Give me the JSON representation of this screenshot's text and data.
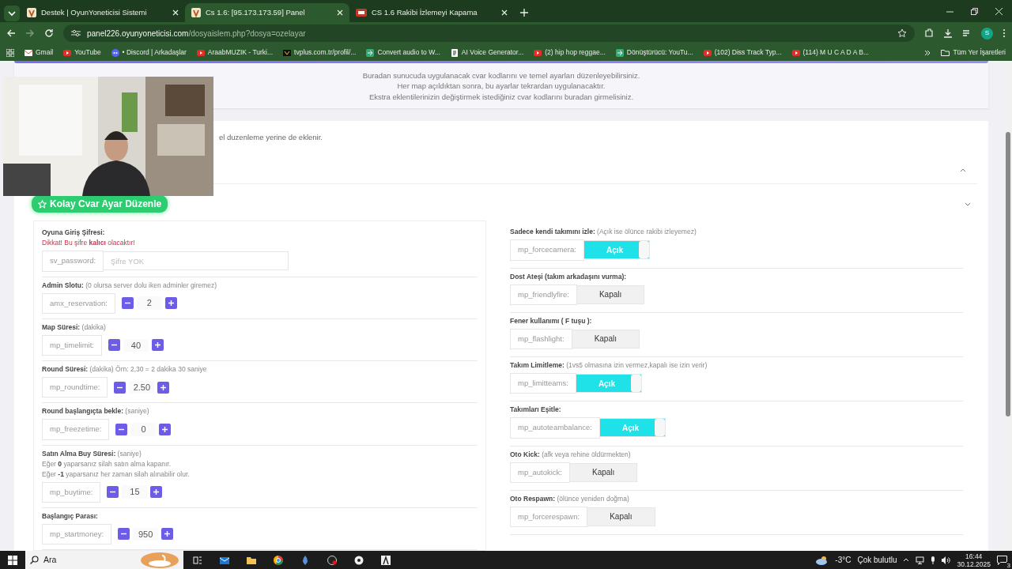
{
  "browser": {
    "tabs": [
      {
        "title": "Destek | OyunYoneticisi Sistemi",
        "kind": "shield",
        "selected": false
      },
      {
        "title": "Cs 1.6: [95.173.173.59] Panel",
        "kind": "shield",
        "selected": true
      },
      {
        "title": "CS 1.6 Rakibi İzlemeyi Kapama",
        "kind": "badge",
        "selected": false
      }
    ],
    "url": {
      "host": "panel226.oyunyoneticisi.com",
      "path": "/dosyaislem.php?dosya=ozelayar"
    },
    "profile": "S",
    "bookmarks": [
      {
        "label": "Gmail",
        "kind": "gmail"
      },
      {
        "label": "YouTube",
        "kind": "youtube"
      },
      {
        "label": "• Discord | Arkadaşlar",
        "kind": "discord"
      },
      {
        "label": "AraabMUZIK - Turki...",
        "kind": "youtube"
      },
      {
        "label": "tvplus.com.tr/profil/...",
        "kind": "tv"
      },
      {
        "label": "Convert audio to W...",
        "kind": "convert"
      },
      {
        "label": "AI Voice Generator...",
        "kind": "ai"
      },
      {
        "label": "(2) hip hop reggae...",
        "kind": "youtube"
      },
      {
        "label": "Dönüştürücü: YouTu...",
        "kind": "convert"
      },
      {
        "label": "(102) Diss Track Typ...",
        "kind": "youtube"
      },
      {
        "label": "(114) M U C A D A B...",
        "kind": "youtube"
      }
    ],
    "all_bookmarks": "Tüm Yer İşaretleri"
  },
  "page": {
    "info_lines": [
      "Buradan sunucuda uygulanacak cvar kodlarını ve temel ayarları düzenleyebilirsiniz.",
      "Her map açıldıktan sonra, bu ayarlar tekrardan uygulanacaktır.",
      "Ekstra eklentilerinizin değiştirmek istediğiniz cvar kodlarını buradan girmelisiniz."
    ],
    "note": "el duzenleme yerine de eklenir.",
    "section_title": "Kolay Cvar Ayar Düzenle",
    "left_settings": [
      {
        "label": "Oyuna Giriş Şifresi:",
        "warning": "Dikkat! Bu şifre **kalıcı** olacaktır!",
        "cvar": "sv_password:",
        "kind": "text",
        "placeholder": "Şifre YOK"
      },
      {
        "label": "Admin Slotu:",
        "hint": "(0 olursa server dolu iken adminler giremez)",
        "cvar": "amx_reservation:",
        "kind": "number",
        "value": "2"
      },
      {
        "label": "Map Süresi:",
        "hint": "(dakika)",
        "cvar": "mp_timelimit:",
        "kind": "number",
        "value": "40"
      },
      {
        "label": "Round Süresi:",
        "hint": "(dakika) Örn: 2,30 = 2 dakika 30 saniye",
        "cvar": "mp_roundtime:",
        "kind": "number",
        "value": "2.50"
      },
      {
        "label": "Round başlangıçta bekle:",
        "hint": "(saniye)",
        "cvar": "mp_freezetime:",
        "kind": "number",
        "value": "0"
      },
      {
        "label": "Satın Alma Buy Süresi:",
        "hint": "(saniye)",
        "notes": [
          "Eğer **0** yaparsanız silah satın alma kapanır.",
          "Eğer **-1** yaparsanız her zaman silah alınabilir olur."
        ],
        "cvar": "mp_buytime:",
        "kind": "number",
        "value": "15"
      },
      {
        "label": "Başlangıç Parası:",
        "cvar": "mp_startmoney:",
        "kind": "number",
        "value": "950"
      }
    ],
    "right_settings": [
      {
        "label": "Sadece kendi takımını izle:",
        "hint": "(Açık ise ölünce rakibi izleyemez)",
        "cvar": "mp_forcecamera:",
        "on": true,
        "state_label": "Açık"
      },
      {
        "label": "Dost Ateşi (takım arkadaşını vurma):",
        "cvar": "mp_friendlyfire:",
        "on": false,
        "state_label": "Kapalı"
      },
      {
        "label": "Fener kullanımı ( F tuşu ):",
        "cvar": "mp_flashlight:",
        "on": false,
        "state_label": "Kapalı"
      },
      {
        "label": "Takım Limitleme:",
        "hint": "(1vs5 olmasına izin vermez,kapalı ise izin verir)",
        "cvar": "mp_limitteams:",
        "on": true,
        "state_label": "Açık"
      },
      {
        "label": "Takımları Eşitle:",
        "cvar": "mp_autoteambalance:",
        "on": true,
        "state_label": "Açık"
      },
      {
        "label": "Oto Kick:",
        "hint": "(afk veya rehine öldürmekten)",
        "cvar": "mp_autokick:",
        "on": false,
        "state_label": "Kapalı"
      },
      {
        "label": "Oto Respawn:",
        "hint": "(ölünce yeniden doğma)",
        "cvar": "mp_forcerespawn:",
        "on": false,
        "state_label": "Kapalı"
      }
    ]
  },
  "taskbar": {
    "search": "Ara",
    "temperature": "-3°C",
    "weather": "Çok bulutlu",
    "time": "16:44",
    "date": "30.12.2025",
    "notifications": "3"
  }
}
